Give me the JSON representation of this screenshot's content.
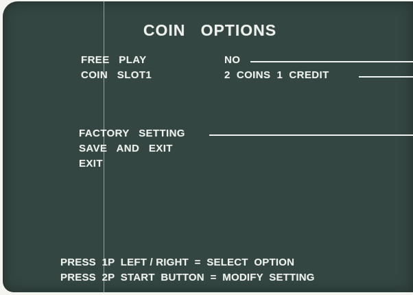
{
  "screen": {
    "title": "COIN   OPTIONS",
    "options": [
      {
        "label": "FREE   PLAY",
        "value": "NO"
      },
      {
        "label": "COIN   SLOT1",
        "value": "2  COINS  1  CREDIT"
      }
    ],
    "actions": [
      {
        "label": "FACTORY   SETTING"
      },
      {
        "label": "SAVE   AND   EXIT"
      },
      {
        "label": "EXIT"
      }
    ],
    "footer": [
      "PRESS  1P  LEFT / RIGHT  =  SELECT  OPTION",
      "PRESS  2P  START  BUTTON  =  MODIFY  SETTING"
    ],
    "colors": {
      "background": "#334641",
      "text": "#eef1ee",
      "paper": "#f4f4f1"
    }
  }
}
